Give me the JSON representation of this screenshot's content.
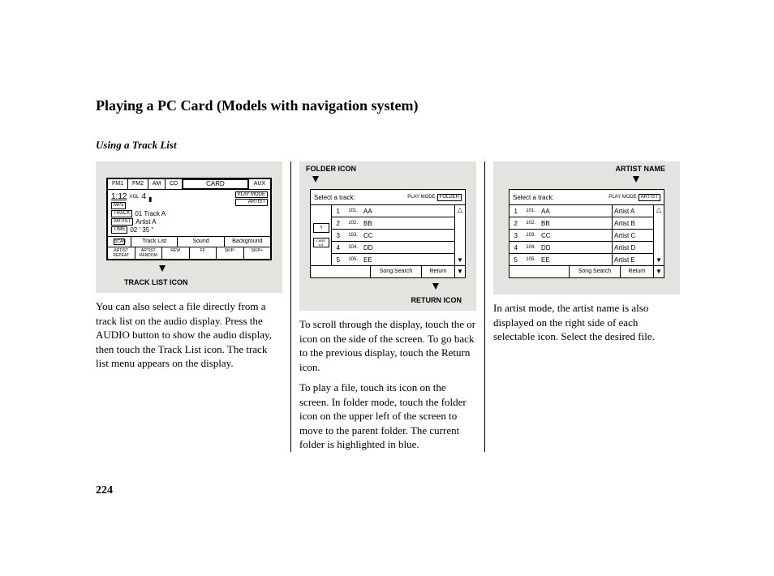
{
  "page_title": "Playing a PC Card (Models with navigation system)",
  "subtitle": "Using a Track List",
  "page_number": "224",
  "fig1": {
    "header": {
      "fm1": "FM1",
      "fm2": "FM2",
      "am": "AM",
      "cd": "CD",
      "card": "CARD",
      "aux": "AUX"
    },
    "time": "1:12",
    "vol_label": "VOL",
    "vol_value": "4",
    "mp3_tag": "MP3",
    "play_mode": "PLAY MODE",
    "artist_btn": "ARTIST",
    "track_tag": "TRACK",
    "track_value": "01  Track  A",
    "artist_tag": "ARTIST",
    "artist_value": "Artist  A",
    "time_tag": "TIME",
    "time_value": "02 ' 35 ''",
    "row": {
      "scan": "SCAN",
      "tracklist": "Track List",
      "sound": "Sound",
      "background": "Background"
    },
    "bottom": [
      "ARTIST REPEAT",
      "ARTIST RANDOM",
      "REW",
      "FF",
      "SKIP-",
      "SKIP+"
    ],
    "label": "TRACK LIST ICON"
  },
  "fig2": {
    "folder_label": "FOLDER ICON",
    "return_label": "RETURN ICON",
    "select": "Select a track:",
    "play_mode": "PLAY MODE",
    "folder_btn": "FOLDER",
    "side_up": "↰",
    "side_card": "CARD",
    "side_num": "101",
    "rows": [
      {
        "idx": "1",
        "trk": "101.",
        "nm": "AA"
      },
      {
        "idx": "2",
        "trk": "102.",
        "nm": "BB"
      },
      {
        "idx": "3",
        "trk": "103.",
        "nm": "CC"
      },
      {
        "idx": "4",
        "trk": "104.",
        "nm": "DD"
      },
      {
        "idx": "5",
        "trk": "105.",
        "nm": "EE"
      }
    ],
    "song_search": "Song Search",
    "return_btn": "Return"
  },
  "fig3": {
    "artist_label": "ARTIST NAME",
    "select": "Select a track:",
    "play_mode": "PLAY MODE",
    "artist_btn": "ARTIST",
    "rows": [
      {
        "idx": "1",
        "trk": "101.",
        "nm": "AA",
        "art": "Artist  A"
      },
      {
        "idx": "2",
        "trk": "102.",
        "nm": "BB",
        "art": "Artist  B"
      },
      {
        "idx": "3",
        "trk": "103.",
        "nm": "CC",
        "art": "Artist  C"
      },
      {
        "idx": "4",
        "trk": "104.",
        "nm": "DD",
        "art": "Artist  D"
      },
      {
        "idx": "5",
        "trk": "105.",
        "nm": "EE",
        "art": "Artist  E"
      }
    ],
    "song_search": "Song Search",
    "return_btn": "Return"
  },
  "col1_text": "You can also select a file directly from a track list on the audio display. Press the AUDIO button to show the audio display, then touch the Track List icon. The track list menu appears on the display.",
  "col2_text1": "To scroll through the display, touch the      or      icon on the side of the screen. To go back to the previous display, touch the Return icon.",
  "col2_text2": "To play a file, touch its icon on the screen. In folder mode, touch the folder icon on the upper left of the screen to move to the parent folder. The current folder is highlighted in blue.",
  "col3_text": "In artist mode, the artist name is also displayed on the right side of each selectable icon. Select the desired file."
}
